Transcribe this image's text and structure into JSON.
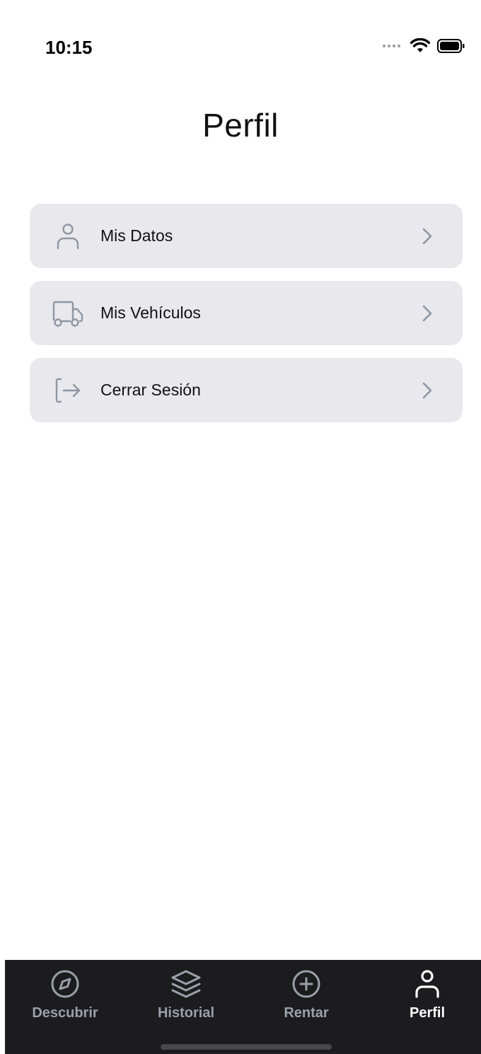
{
  "status_bar": {
    "time": "10:15",
    "icons": [
      "signal-dots-icon",
      "wifi-icon",
      "battery-icon"
    ]
  },
  "header": {
    "title": "Perfil"
  },
  "menu": {
    "items": [
      {
        "label": "Mis Datos",
        "icon": "user-icon"
      },
      {
        "label": "Mis Vehículos",
        "icon": "truck-icon"
      },
      {
        "label": "Cerrar Sesión",
        "icon": "logout-icon"
      }
    ],
    "chevron_icon": "chevron-right-icon"
  },
  "tab_bar": {
    "tabs": [
      {
        "label": "Descubrir",
        "icon": "compass-icon",
        "active": false
      },
      {
        "label": "Historial",
        "icon": "layers-icon",
        "active": false
      },
      {
        "label": "Rentar",
        "icon": "plus-circle-icon",
        "active": false
      },
      {
        "label": "Perfil",
        "icon": "user-icon",
        "active": true
      }
    ]
  },
  "colors": {
    "background": "#ffffff",
    "menu_item_bg": "#e9e9ed",
    "icon_gray": "#8e96a3",
    "tab_bar_bg": "#1c1c1e",
    "tab_inactive": "#9aa0ab",
    "tab_active": "#ffffff"
  }
}
